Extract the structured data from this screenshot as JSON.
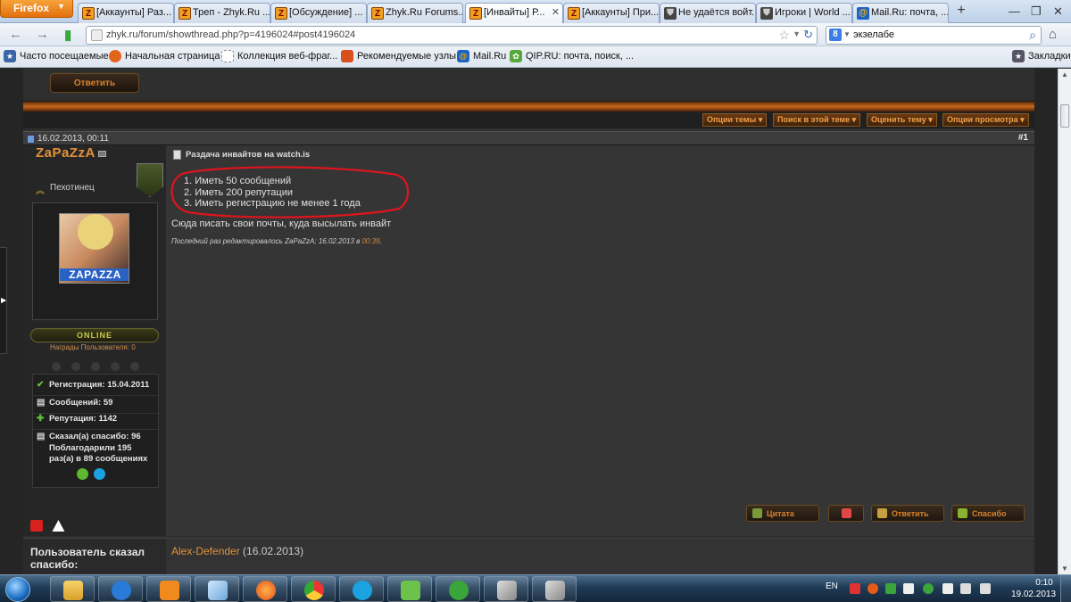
{
  "browser": {
    "app_button": "Firefox",
    "tabs": [
      {
        "label": "[Аккаунты] Раз...",
        "favicon": "Z"
      },
      {
        "label": "Треп - Zhyk.Ru ...",
        "favicon": "Z"
      },
      {
        "label": "[Обсуждение] ...",
        "favicon": "Z"
      },
      {
        "label": "Zhyk.Ru Forums...",
        "favicon": "Z"
      },
      {
        "label": "[Инвайты] Р...",
        "favicon": "Z"
      },
      {
        "label": "[Аккаунты] При...",
        "favicon": "Z"
      },
      {
        "label": "Не удаётся войт...",
        "favicon": "wot"
      },
      {
        "label": "Игроки | World ...",
        "favicon": "wot"
      },
      {
        "label": "Mail.Ru: почта, ...",
        "favicon": "mail"
      }
    ],
    "new_tab": "+",
    "url": "zhyk.ru/forum/showthread.php?p=4196024#post4196024",
    "search_value": "экзелабе",
    "search_engine": "Google"
  },
  "bookmarks": [
    {
      "label": "Часто посещаемые"
    },
    {
      "label": "Начальная страница"
    },
    {
      "label": "Коллекция веб-фраг..."
    },
    {
      "label": "Рекомендуемые узлы"
    },
    {
      "label": "Mail.Ru"
    },
    {
      "label": "QIP.RU: почта, поиск, ..."
    },
    {
      "label": "Закладки"
    }
  ],
  "forum": {
    "reply_button": "Ответить",
    "options": [
      "Опции темы",
      "Поиск в этой теме",
      "Оценить тему",
      "Опции просмотра"
    ],
    "post": {
      "date": "16.02.2013, 00:11",
      "number": "#1",
      "title": "Раздача инвайтов на watch.is",
      "requirements": [
        "1.  Иметь 50 сообщений",
        "2.  Иметь 200 репутации",
        "3.  Иметь регистрацию не менее 1 года"
      ],
      "text": "Сюда писать свои почты, куда высылать инвайт",
      "edited_prefix": "Последний раз редактировалось ZaPaZzA; 16.02.2013 в ",
      "edited_time": "00:39",
      "edited_suffix": ".",
      "buttons": [
        "Цитата",
        "",
        "Ответить",
        "Спасибо"
      ]
    },
    "user": {
      "name": "ZaPaZzA",
      "rank": "Пехотинец",
      "avatar_text": "ZAPAZZA",
      "status": "ONLINE",
      "awards_label": "Награды Пользователя: 0",
      "registration": "Регистрация: 15.04.2011",
      "messages": "Сообщений: 59",
      "reputation": "Репутация: 1142",
      "thanks_given": "Сказал(а) спасибо: 96",
      "thanked_line1": "Поблагодарили 195",
      "thanked_line2": "раз(а) в 89 сообщениях"
    },
    "thanks": {
      "label": "Пользователь сказал спасибо:",
      "user": "Alex-Defender",
      "date": " (16.02.2013)"
    }
  },
  "taskbar": {
    "lang": "EN",
    "time": "0:10",
    "date": "19.02.2013"
  },
  "colors": {
    "accent_orange": "#e3913a",
    "annotation_red": "#e0141e",
    "post_bg": "#353535"
  }
}
